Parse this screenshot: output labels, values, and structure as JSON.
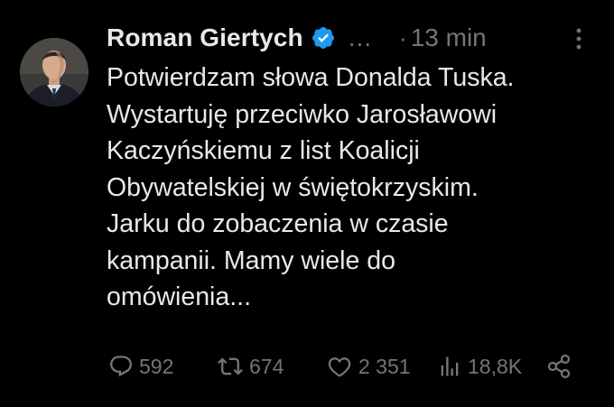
{
  "author": {
    "name": "Roman Giertych",
    "verified_badge_color": "#1d9bf0",
    "avatar": "profile-photo"
  },
  "header": {
    "ellipsis": "...",
    "separator": "·",
    "timestamp": "13 min"
  },
  "tweet": {
    "text": "Potwierdzam słowa Donalda Tuska.\nWystartuję przeciwko Jarosławowi\nKaczyńskiemu z list Koalicji\nObywatelskiej w świętokrzyskim.\nJarku do zobaczenia w czasie\nkampanii. Mamy wiele do\nomówienia..."
  },
  "actions": {
    "replies": "592",
    "reposts": "674",
    "likes": "2 351",
    "views": "18,8K"
  },
  "icons": {
    "reply": "speech-bubble-icon",
    "repost": "repost-arrows-icon",
    "like": "heart-icon",
    "views": "bar-chart-icon",
    "share": "share-icon",
    "more": "vertical-dots-icon"
  },
  "colors": {
    "background": "#000000",
    "text_primary": "#e7e9ea",
    "text_secondary": "#71767b",
    "accent": "#1d9bf0"
  }
}
